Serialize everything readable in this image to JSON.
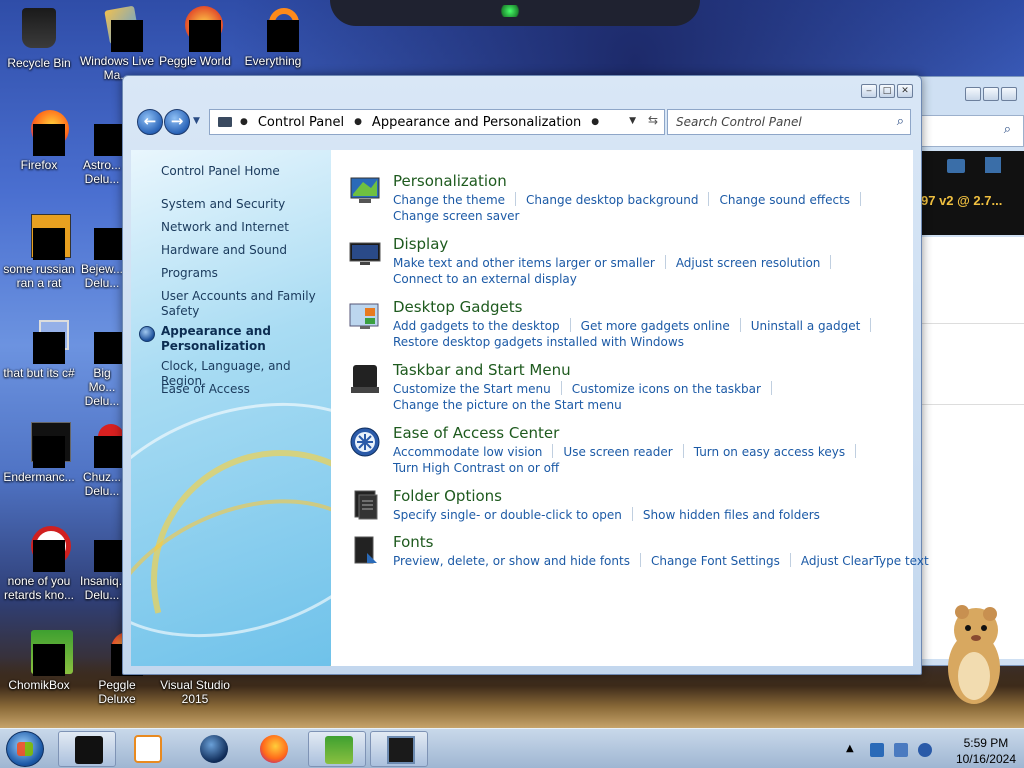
{
  "desktop": {
    "icons": [
      {
        "label": "Recycle Bin"
      },
      {
        "label": "Windows Live Ma..."
      },
      {
        "label": "Peggle World"
      },
      {
        "label": "Everything"
      },
      {
        "label": "Firefox"
      },
      {
        "label": "Astro... Delu..."
      },
      {
        "label": "some russian ran a rat"
      },
      {
        "label": "Bejew... Delu..."
      },
      {
        "label": "that but its c#"
      },
      {
        "label": "Big Mo... Delu..."
      },
      {
        "label": "Endermanc..."
      },
      {
        "label": "Chuz... Delu..."
      },
      {
        "label": "none of you retards kno..."
      },
      {
        "label": "Insaniq... Delu..."
      },
      {
        "label": "ChomikBox"
      },
      {
        "label": "Peggle Deluxe"
      },
      {
        "label": "Visual Studio 2015"
      }
    ],
    "background_window_text": "97 v2 @ 2.7..."
  },
  "window": {
    "breadcrumb": [
      "Control Panel",
      "Appearance and Personalization"
    ],
    "search_placeholder": "Search Control Panel"
  },
  "sidebar": {
    "items": [
      {
        "label": "Control Panel Home"
      },
      {
        "label": "System and Security"
      },
      {
        "label": "Network and Internet"
      },
      {
        "label": "Hardware and Sound"
      },
      {
        "label": "Programs"
      },
      {
        "label": "User Accounts and Family Safety"
      },
      {
        "label": "Appearance and Personalization"
      },
      {
        "label": "Clock, Language, and Region"
      },
      {
        "label": "Ease of Access"
      }
    ]
  },
  "categories": [
    {
      "title": "Personalization",
      "rows": [
        [
          "Change the theme",
          "Change desktop background",
          "Change sound effects"
        ],
        [
          "Change screen saver"
        ]
      ]
    },
    {
      "title": "Display",
      "rows": [
        [
          "Make text and other items larger or smaller",
          "Adjust screen resolution"
        ],
        [
          "Connect to an external display"
        ]
      ]
    },
    {
      "title": "Desktop Gadgets",
      "rows": [
        [
          "Add gadgets to the desktop",
          "Get more gadgets online",
          "Uninstall a gadget"
        ],
        [
          "Restore desktop gadgets installed with Windows"
        ]
      ]
    },
    {
      "title": "Taskbar and Start Menu",
      "rows": [
        [
          "Customize the Start menu",
          "Customize icons on the taskbar"
        ],
        [
          "Change the picture on the Start menu"
        ]
      ]
    },
    {
      "title": "Ease of Access Center",
      "rows": [
        [
          "Accommodate low vision",
          "Use screen reader",
          "Turn on easy access keys"
        ],
        [
          "Turn High Contrast on or off"
        ]
      ]
    },
    {
      "title": "Folder Options",
      "rows": [
        [
          "Specify single- or double-click to open",
          "Show hidden files and folders"
        ]
      ]
    },
    {
      "title": "Fonts",
      "rows": [
        [
          "Preview, delete, or show and hide fonts",
          "Change Font Settings",
          "Adjust ClearType text"
        ]
      ]
    }
  ],
  "taskbar": {
    "time": "5:59 PM",
    "date": "10/16/2024"
  },
  "colors": {
    "link": "#1c5aa6",
    "category_title": "#1e5a1e",
    "sidebar_text": "#1a3a5c"
  }
}
